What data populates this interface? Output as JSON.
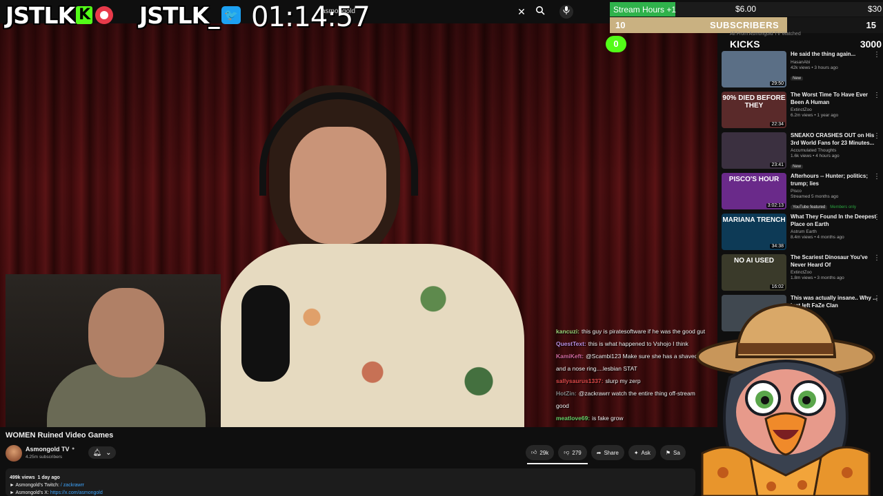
{
  "overlay": {
    "logo_left": "JSTLK",
    "logo_left_badge": "K",
    "logo_right": "JSTLK_",
    "timer": "01:14:57",
    "search_value": "asmongold"
  },
  "stream_hours": {
    "label": "Stream Hours",
    "increment": "+1",
    "mid": "$6.00",
    "right": "$30",
    "fill_fraction": 0.24
  },
  "subscribers": {
    "left": "10",
    "label": "SUBSCRIBERS",
    "right": "15",
    "fill_fraction": 0.65
  },
  "kicks": {
    "left": "0",
    "label": "KICKS",
    "right": "3000"
  },
  "sidebar_tabs_faint": "All    From Asmongold TV    Watched",
  "recommendations": [
    {
      "title": "He said the thing again...",
      "channel": "HasanAbi",
      "stats": "42k views • 3 hours ago",
      "badge": "New",
      "duration": "29:50",
      "thumb_text": "",
      "thumb_color": "#5b6f86"
    },
    {
      "title": "The Worst Time To Have Ever Been A Human",
      "channel": "ExtinctZoo",
      "stats": "6.2m views • 1 year ago",
      "badge": "",
      "duration": "22:34",
      "thumb_text": "90% DIED BEFORE THEY",
      "thumb_color": "#5a2a2a"
    },
    {
      "title": "SNEAKO CRASHES OUT on His 3rd World Fans for 23 Minutes...",
      "channel": "Accumulated Thoughts",
      "stats": "1.6k views • 4 hours ago",
      "badge": "New",
      "duration": "23:41",
      "thumb_text": "",
      "thumb_color": "#3b3040"
    },
    {
      "title": "Afterhours -- Hunter; politics; trump; lies",
      "channel": "Pisco",
      "stats": "Streamed 5 months ago",
      "badge": "YouTube featured",
      "members": "Members only",
      "duration": "3:02:13",
      "thumb_text": "PISCO'S HOUR",
      "thumb_color": "#6a2a8a"
    },
    {
      "title": "What They Found In the Deepest Place on Earth",
      "channel": "Astrum Earth",
      "stats": "8.4m views • 4 months ago",
      "badge": "",
      "duration": "34:38",
      "thumb_text": "MARIANA TRENCH",
      "thumb_color": "#0d3a56"
    },
    {
      "title": "The Scariest Dinosaur You've Never Heard Of",
      "channel": "ExtinctZoo",
      "stats": "1.8m views • 3 months ago",
      "badge": "",
      "duration": "16:02",
      "thumb_text": "NO AI USED",
      "thumb_color": "#3a3a2a"
    },
    {
      "title": "This was actually insane.. Why ... just left FaZe Clan",
      "channel": "",
      "stats": "",
      "badge": "",
      "duration": "",
      "thumb_text": "",
      "thumb_color": "#404850"
    }
  ],
  "chat": [
    {
      "user": "kancuzi:",
      "text": "this guy is piratesoftware if he was the good gut",
      "color": "#9ed37a"
    },
    {
      "user": "QuestText:",
      "text": "this is what happened to Vshojo I think",
      "color": "#b98fe0"
    },
    {
      "user": "KamiKeft:",
      "text": "@Scambi123 Make sure she has a shaved",
      "color": "#d36aa0"
    },
    {
      "user": "",
      "text": "and a nose ring....lesbian STAT",
      "color": "#ffffff"
    },
    {
      "user": "sallysaurus1337:",
      "text": "slurp my zerp",
      "color": "#e04a4a"
    },
    {
      "user": "HotZin:",
      "text": "@zackrawrr watch the entire thing off-stream",
      "color": "#888888"
    },
    {
      "user": "",
      "text": "good",
      "color": "#ffffff"
    },
    {
      "user": "meatlove69:",
      "text": "is fake grow",
      "color": "#6ad36a"
    }
  ],
  "video": {
    "title": "WOMEN Ruined Video Games",
    "channel": "Asmongold TV",
    "subscribers": "4.25m subscribers",
    "likes": "29k",
    "dislikes": "279",
    "share": "Share",
    "ask": "Ask",
    "save": "Sa"
  },
  "description": {
    "views": "499k views",
    "date": "1 day ago",
    "line1_label": "► Asmongold's Twitch:",
    "line1_link": "/ zackrawrr",
    "line2_label": "► Asmongold's X:",
    "line2_link": "https://x.com/asmongold"
  }
}
